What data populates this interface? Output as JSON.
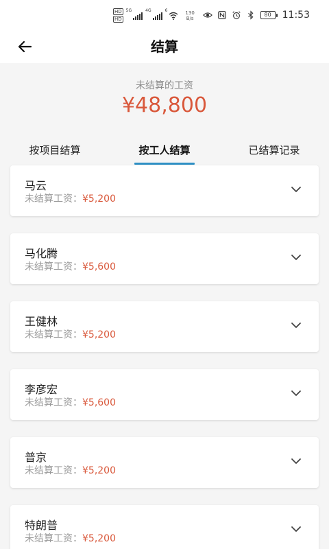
{
  "status_bar": {
    "hd_top": "HD",
    "hd_bottom": "HD",
    "net1": "5G",
    "net2": "4G",
    "wifi_tag": "6",
    "speed_value": "130",
    "speed_unit": "B/s",
    "battery": "80",
    "time": "11:53"
  },
  "header": {
    "title": "结算"
  },
  "summary": {
    "label": "未结算的工资",
    "amount": "¥48,800"
  },
  "tabs": [
    {
      "label": "按项目结算",
      "active": false
    },
    {
      "label": "按工人结算",
      "active": true
    },
    {
      "label": "已结算记录",
      "active": false
    }
  ],
  "workers": [
    {
      "name": "马云",
      "label": "未结算工资：",
      "amount": "¥5,200"
    },
    {
      "name": "马化腾",
      "label": "未结算工资：",
      "amount": "¥5,600"
    },
    {
      "name": "王健林",
      "label": "未结算工资：",
      "amount": "¥5,200"
    },
    {
      "name": "李彦宏",
      "label": "未结算工资：",
      "amount": "¥5,600"
    },
    {
      "name": "普京",
      "label": "未结算工资：",
      "amount": "¥5,200"
    },
    {
      "name": "特朗普",
      "label": "未结算工资：",
      "amount": "¥5,200"
    }
  ],
  "colors": {
    "accent_red": "#d9583b",
    "tab_indicator": "#2e8fc4",
    "background": "#f5f5f5"
  },
  "icons": {
    "back": "arrow-left-icon",
    "expand": "chevron-down-icon"
  }
}
